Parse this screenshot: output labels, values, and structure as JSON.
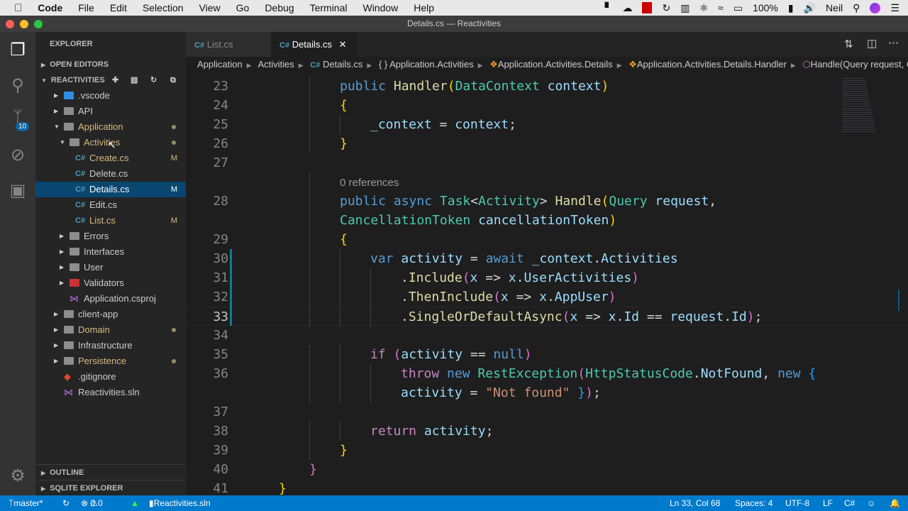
{
  "menubar": {
    "app": "Code",
    "items": [
      "File",
      "Edit",
      "Selection",
      "View",
      "Go",
      "Debug",
      "Terminal",
      "Window",
      "Help"
    ],
    "battery": "100%",
    "user": "Neil"
  },
  "window_title": "Details.cs — Reactivities",
  "activity_badge": "10",
  "sidebar": {
    "title": "EXPLORER",
    "open_editors": "OPEN EDITORS",
    "project": "REACTIVITIES",
    "outline": "OUTLINE",
    "sqlite": "SQLITE EXPLORER",
    "tree": [
      {
        "label": "vscode",
        "display": ".vscode",
        "depth": 1,
        "type": "folder-vscode",
        "twisty": "closed"
      },
      {
        "label": "API",
        "depth": 1,
        "type": "folder",
        "twisty": "closed"
      },
      {
        "label": "Application",
        "depth": 1,
        "type": "folder",
        "twisty": "open",
        "color": "#d7ba7d",
        "dot": true
      },
      {
        "label": "Activities",
        "depth": 2,
        "type": "folder",
        "twisty": "open",
        "color": "#d7ba7d",
        "dot": true
      },
      {
        "label": "Create.cs",
        "depth": 3,
        "type": "cs",
        "color": "#d7ba7d",
        "deco": "M"
      },
      {
        "label": "Delete.cs",
        "depth": 3,
        "type": "cs"
      },
      {
        "label": "Details.cs",
        "depth": 3,
        "type": "cs",
        "selected": true,
        "deco": "M"
      },
      {
        "label": "Edit.cs",
        "depth": 3,
        "type": "cs"
      },
      {
        "label": "List.cs",
        "depth": 3,
        "type": "cs",
        "color": "#d7ba7d",
        "deco": "M"
      },
      {
        "label": "Errors",
        "depth": 2,
        "type": "folder",
        "twisty": "closed"
      },
      {
        "label": "Interfaces",
        "depth": 2,
        "type": "folder",
        "twisty": "closed"
      },
      {
        "label": "User",
        "depth": 2,
        "type": "folder",
        "twisty": "closed"
      },
      {
        "label": "Validators",
        "depth": 2,
        "type": "folder-red",
        "twisty": "closed"
      },
      {
        "label": "Application.csproj",
        "depth": 2,
        "type": "proj"
      },
      {
        "label": "client-app",
        "depth": 1,
        "type": "folder",
        "twisty": "closed"
      },
      {
        "label": "Domain",
        "depth": 1,
        "type": "folder",
        "twisty": "closed",
        "color": "#d7ba7d",
        "dot": true
      },
      {
        "label": "Infrastructure",
        "depth": 1,
        "type": "folder",
        "twisty": "closed"
      },
      {
        "label": "Persistence",
        "depth": 1,
        "type": "folder",
        "twisty": "closed",
        "color": "#d7ba7d",
        "dot": true
      },
      {
        "label": ".gitignore",
        "depth": 1,
        "type": "git"
      },
      {
        "label": "Reactivities.sln",
        "depth": 1,
        "type": "proj"
      }
    ]
  },
  "tabs": [
    {
      "label": "List.cs",
      "active": false
    },
    {
      "label": "Details.cs",
      "active": true
    }
  ],
  "breadcrumbs": [
    "Application",
    "Activities",
    "Details.cs",
    "{ } Application.Activities",
    "Application.Activities.Details",
    "Application.Activities.Details.Handler",
    "Handle(Query request, CancellationToken cancellationToken)"
  ],
  "code_rows": [
    {
      "n": "23",
      "i": 3,
      "tk": [
        [
          "k",
          "public "
        ],
        [
          "m",
          "Handler"
        ],
        [
          "y",
          "("
        ],
        [
          "t",
          "DataContext"
        ],
        [
          "p",
          " "
        ],
        [
          "v",
          "context"
        ],
        [
          "y",
          ")"
        ]
      ]
    },
    {
      "n": "24",
      "i": 3,
      "tk": [
        [
          "y",
          "{"
        ]
      ]
    },
    {
      "n": "25",
      "i": 4,
      "tk": [
        [
          "v",
          "_context"
        ],
        [
          "p",
          " = "
        ],
        [
          "v",
          "context"
        ],
        [
          "p",
          ";"
        ]
      ]
    },
    {
      "n": "26",
      "i": 3,
      "tk": [
        [
          "y",
          "}"
        ]
      ]
    },
    {
      "n": "27",
      "i": 0,
      "tk": []
    },
    {
      "n": "",
      "i": 3,
      "tk": [
        [
          "lens",
          "0 references"
        ]
      ]
    },
    {
      "n": "28",
      "i": 3,
      "tk": [
        [
          "k",
          "public async "
        ],
        [
          "t",
          "Task"
        ],
        [
          "p",
          "<"
        ],
        [
          "t",
          "Activity"
        ],
        [
          "p",
          "> "
        ],
        [
          "m",
          "Handle"
        ],
        [
          "y",
          "("
        ],
        [
          "t",
          "Query"
        ],
        [
          "p",
          " "
        ],
        [
          "v",
          "request"
        ],
        [
          "p",
          ","
        ]
      ]
    },
    {
      "n": "",
      "i": 3,
      "tk": [
        [
          "t",
          "CancellationToken"
        ],
        [
          "p",
          " "
        ],
        [
          "v",
          "cancellationToken"
        ],
        [
          "y",
          ")"
        ]
      ]
    },
    {
      "n": "29",
      "i": 3,
      "tk": [
        [
          "y",
          "{"
        ]
      ]
    },
    {
      "n": "30",
      "i": 4,
      "tk": [
        [
          "k",
          "var "
        ],
        [
          "v",
          "activity"
        ],
        [
          "p",
          " = "
        ],
        [
          "k",
          "await "
        ],
        [
          "v",
          "_context"
        ],
        [
          "p",
          "."
        ],
        [
          "v",
          "Activities"
        ]
      ]
    },
    {
      "n": "31",
      "i": 5,
      "tk": [
        [
          "p",
          "."
        ],
        [
          "m",
          "Include"
        ],
        [
          "g",
          "("
        ],
        [
          "v",
          "x"
        ],
        [
          "p",
          " => "
        ],
        [
          "v",
          "x"
        ],
        [
          "p",
          "."
        ],
        [
          "v",
          "UserActivities"
        ],
        [
          "g",
          ")"
        ]
      ]
    },
    {
      "n": "32",
      "i": 5,
      "tk": [
        [
          "p",
          "."
        ],
        [
          "m",
          "ThenInclude"
        ],
        [
          "g",
          "("
        ],
        [
          "v",
          "x"
        ],
        [
          "p",
          " => "
        ],
        [
          "v",
          "x"
        ],
        [
          "p",
          "."
        ],
        [
          "v",
          "AppUser"
        ],
        [
          "g",
          ")"
        ]
      ]
    },
    {
      "n": "33",
      "i": 5,
      "cur": true,
      "tk": [
        [
          "p",
          "."
        ],
        [
          "m",
          "SingleOrDefaultAsync"
        ],
        [
          "g",
          "("
        ],
        [
          "v",
          "x"
        ],
        [
          "p",
          " => "
        ],
        [
          "v",
          "x"
        ],
        [
          "p",
          "."
        ],
        [
          "v",
          "Id"
        ],
        [
          "p",
          " == "
        ],
        [
          "v",
          "request"
        ],
        [
          "p",
          "."
        ],
        [
          "v",
          "Id"
        ],
        [
          "g",
          ")"
        ],
        [
          "p",
          ";"
        ]
      ]
    },
    {
      "n": "34",
      "i": 0,
      "tk": []
    },
    {
      "n": "35",
      "i": 4,
      "tk": [
        [
          "c",
          "if "
        ],
        [
          "g",
          "("
        ],
        [
          "v",
          "activity"
        ],
        [
          "p",
          " == "
        ],
        [
          "k",
          "null"
        ],
        [
          "g",
          ")"
        ]
      ]
    },
    {
      "n": "36",
      "i": 5,
      "tk": [
        [
          "c",
          "throw "
        ],
        [
          "k",
          "new "
        ],
        [
          "t",
          "RestException"
        ],
        [
          "g",
          "("
        ],
        [
          "t",
          "HttpStatusCode"
        ],
        [
          "p",
          "."
        ],
        [
          "v",
          "NotFound"
        ],
        [
          "p",
          ", "
        ],
        [
          "k",
          "new "
        ],
        [
          "b",
          "{"
        ]
      ]
    },
    {
      "n": "",
      "i": 5,
      "tk": [
        [
          "v",
          "activity"
        ],
        [
          "p",
          " = "
        ],
        [
          "s",
          "\"Not found\""
        ],
        [
          "p",
          " "
        ],
        [
          "b",
          "}"
        ],
        [
          "g",
          ")"
        ],
        [
          "p",
          ";"
        ]
      ]
    },
    {
      "n": "37",
      "i": 0,
      "tk": []
    },
    {
      "n": "38",
      "i": 4,
      "tk": [
        [
          "c",
          "return "
        ],
        [
          "v",
          "activity"
        ],
        [
          "p",
          ";"
        ]
      ]
    },
    {
      "n": "39",
      "i": 3,
      "tk": [
        [
          "y",
          "}"
        ]
      ]
    },
    {
      "n": "40",
      "i": 2,
      "tk": [
        [
          "g",
          "}"
        ]
      ]
    },
    {
      "n": "41",
      "i": 1,
      "tk": [
        [
          "y",
          "}"
        ]
      ]
    }
  ],
  "status": {
    "branch": "master*",
    "errors": "0",
    "warnings": "0",
    "solution": "Reactivities.sln",
    "position": "Ln 33, Col 68",
    "spaces": "Spaces: 4",
    "encoding": "UTF-8",
    "eol": "LF",
    "language": "C#"
  }
}
